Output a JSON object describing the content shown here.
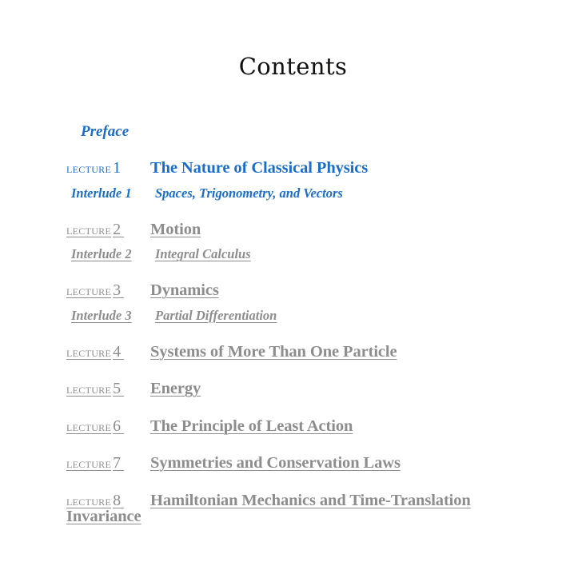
{
  "page": {
    "title": "Contents",
    "background_color": "#ffffff",
    "link_color": "#1a6ecb",
    "visited_link_color": "#8d8d8d",
    "title_color": "#10100e"
  },
  "toc": {
    "preface": {
      "label": "Preface",
      "state": "unvisited"
    },
    "entries": [
      {
        "kind": "lecture",
        "label_word": "lecture",
        "number": "1",
        "title": "The Nature of Classical Physics",
        "state": "unvisited"
      },
      {
        "kind": "interlude",
        "label": "Interlude 1",
        "title": "Spaces, Trigonometry, and Vectors",
        "state": "unvisited"
      },
      {
        "kind": "lecture",
        "label_word": "lecture",
        "number": "2",
        "title": "Motion",
        "state": "visited"
      },
      {
        "kind": "interlude",
        "label": "Interlude 2",
        "title": "Integral Calculus",
        "state": "visited"
      },
      {
        "kind": "lecture",
        "label_word": "lecture",
        "number": "3",
        "title": "Dynamics",
        "state": "visited"
      },
      {
        "kind": "interlude",
        "label": "Interlude 3",
        "title": "Partial Differentiation",
        "state": "visited"
      },
      {
        "kind": "lecture",
        "label_word": "lecture",
        "number": "4",
        "title": "Systems of More Than One Particle",
        "state": "visited"
      },
      {
        "kind": "lecture",
        "label_word": "lecture",
        "number": "5",
        "title": "Energy",
        "state": "visited"
      },
      {
        "kind": "lecture",
        "label_word": "lecture",
        "number": "6",
        "title": "The Principle of Least Action",
        "state": "visited"
      },
      {
        "kind": "lecture",
        "label_word": "lecture",
        "number": "7",
        "title": "Symmetries and Conservation Laws",
        "state": "visited"
      },
      {
        "kind": "lecture",
        "label_word": "lecture",
        "number": "8",
        "title": "Hamiltonian Mechanics and Time-Translation Invariance",
        "state": "visited"
      }
    ]
  }
}
